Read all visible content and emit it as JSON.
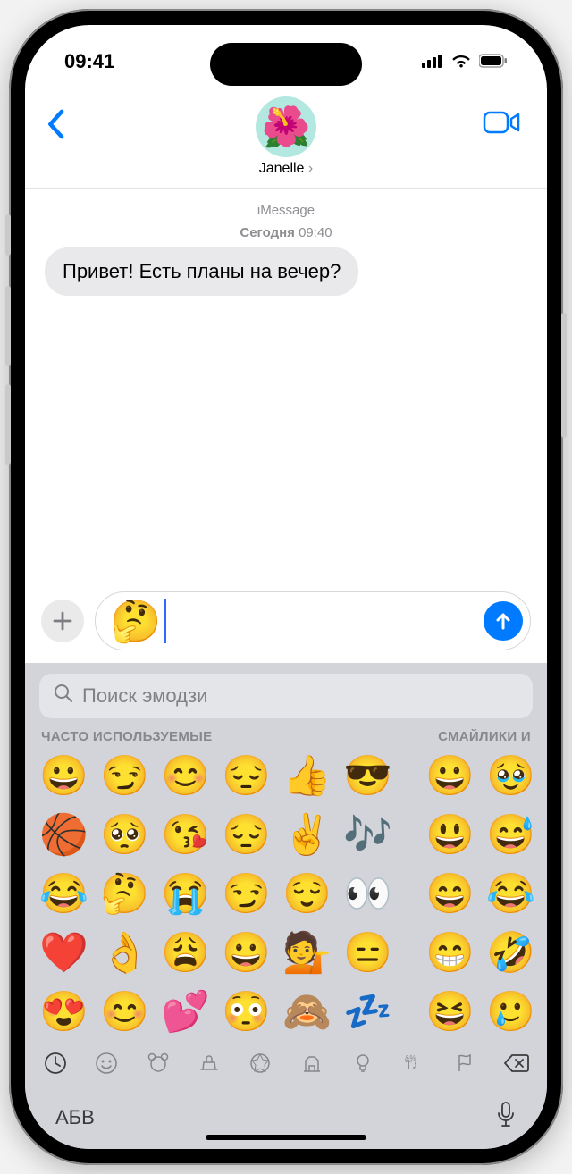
{
  "status": {
    "time": "09:41"
  },
  "header": {
    "contact_name": "Janelle",
    "avatar_emoji": "🌺"
  },
  "chat": {
    "service_label": "iMessage",
    "date_prefix": "Сегодня",
    "date_time": "09:40",
    "incoming_message": "Привет! Есть планы на вечер?",
    "draft_emoji": "🤔"
  },
  "keyboard": {
    "search_placeholder": "Поиск эмодзи",
    "section_frequent": "ЧАСТО ИСПОЛЬЗУЕМЫЕ",
    "section_smileys": "СМАЙЛИКИ И",
    "abc_label": "АБВ",
    "rows": [
      {
        "left": [
          "😀",
          "😏",
          "😊",
          "😔",
          "👍",
          "😎"
        ],
        "right": [
          "😀",
          "🥹"
        ]
      },
      {
        "left": [
          "🏀",
          "🥺",
          "😘",
          "😔",
          "✌️",
          "🎶"
        ],
        "right": [
          "😃",
          "😅"
        ]
      },
      {
        "left": [
          "😂",
          "🤔",
          "😭",
          "😏",
          "😌",
          "👀"
        ],
        "right": [
          "😄",
          "😂"
        ]
      },
      {
        "left": [
          "❤️",
          "👌",
          "😩",
          "😀",
          "💁",
          "😑"
        ],
        "right": [
          "😁",
          "🤣"
        ]
      },
      {
        "left": [
          "😍",
          "😊",
          "💕",
          "😳",
          "🙈",
          "💤"
        ],
        "right": [
          "😆",
          "🥲"
        ]
      }
    ]
  }
}
